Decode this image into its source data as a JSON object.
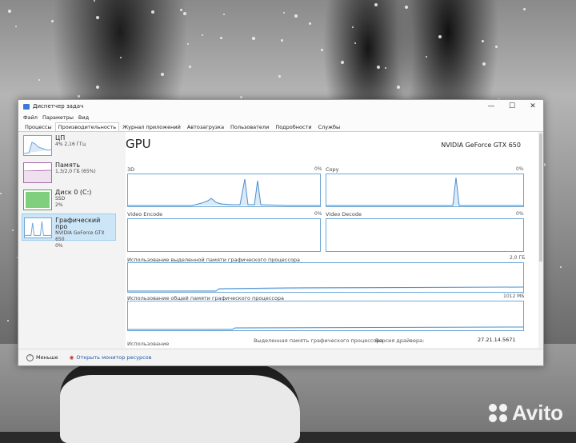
{
  "window": {
    "title": "Диспетчер задач",
    "minimize": "—",
    "maximize": "☐",
    "close": "✕"
  },
  "menu": [
    "Файл",
    "Параметры",
    "Вид"
  ],
  "tabs": [
    "Процессы",
    "Производительность",
    "Журнал приложений",
    "Автозагрузка",
    "Пользователи",
    "Подробности",
    "Службы"
  ],
  "active_tab": 1,
  "sidebar": [
    {
      "name": "ЦП",
      "sub1": "4% 2,16 ГГц",
      "sub2": ""
    },
    {
      "name": "Память",
      "sub1": "1,3/2,0 ГБ (65%)",
      "sub2": ""
    },
    {
      "name": "Диск 0 (C:)",
      "sub1": "SSD",
      "sub2": "2%"
    },
    {
      "name": "Графический про",
      "sub1": "NVIDIA GeForce GTX 650",
      "sub2": "0%"
    }
  ],
  "main": {
    "title": "GPU",
    "model": "NVIDIA GeForce GTX 650",
    "engines": [
      {
        "label": "3D",
        "pct": "0%"
      },
      {
        "label": "Copy",
        "pct": "0%"
      },
      {
        "label": "Video Encode",
        "pct": "0%"
      },
      {
        "label": "Video Decode",
        "pct": "0%"
      }
    ],
    "dedicated_label": "Использование выделенной памяти графического процессора",
    "dedicated_max": "2,0 ГБ",
    "shared_label": "Использование общей памяти графического процессора",
    "shared_max": "1012 МБ",
    "bottom_usage": "Использование",
    "bottom_dedicated": "Выделенная память графического процессора",
    "bottom_driver": "Версия драйвера:",
    "driver_version": "27.21.14.5671"
  },
  "footer": {
    "less": "Меньше",
    "resource_monitor": "Открыть монитор ресурсов"
  },
  "watermark": "Avito",
  "colors": {
    "accent": "#6ea6d6",
    "memory": "#a86aa8",
    "disk": "#4fa14f",
    "link": "#1e5aa8"
  }
}
